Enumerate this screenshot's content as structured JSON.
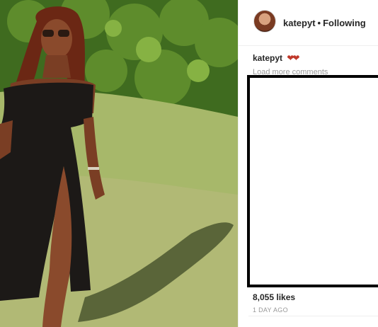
{
  "post": {
    "username": "katepyt",
    "separator": "•",
    "follow_status": "Following",
    "caption_user": "katepyt",
    "caption_emoji": "❤❤",
    "load_more": "Load more comments",
    "likes": "8,055 likes",
    "date": "1 DAY AGO"
  },
  "colors": {
    "text": "#262626",
    "muted": "#999999",
    "heart": "#c0392b"
  }
}
